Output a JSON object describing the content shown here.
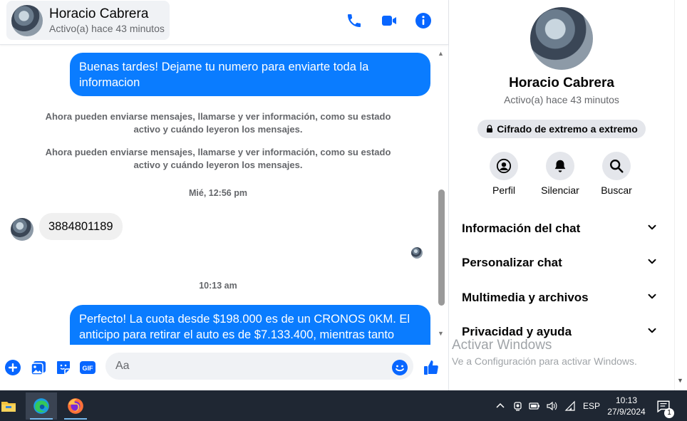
{
  "header": {
    "contact_name": "Horacio Cabrera",
    "contact_status": "Activo(a) hace 43 minutos",
    "icons": [
      "phone-icon",
      "video-camera-icon",
      "info-icon"
    ]
  },
  "messages": {
    "outgoing_1": "Buenas tardes! Dejame tu numero para enviarte toda la informacion",
    "system_1": "Ahora pueden enviarse mensajes, llamarse y ver información, como su estado activo y cuándo leyeron los mensajes.",
    "system_2": "Ahora pueden enviarse mensajes, llamarse y ver información, como su estado activo y cuándo leyeron los mensajes.",
    "time_1": "Mié, 12:56 pm",
    "incoming_1": "3884801189",
    "time_2": "10:13 am",
    "outgoing_2": "Perfecto! La cuota desde $198.000 es de un CRONOS 0KM. El anticipo para retirar el auto es de $7.133.400, mientras tanto"
  },
  "composer": {
    "placeholder": "Aa",
    "gif_label": "GIF",
    "icons": [
      "plus-circle-icon",
      "photo-icon",
      "sticker-icon",
      "gif-icon",
      "emoji-icon",
      "thumbs-up-icon"
    ]
  },
  "info_panel": {
    "name": "Horacio Cabrera",
    "status": "Activo(a) hace 43 minutos",
    "encryption_badge": "Cifrado de extremo a extremo",
    "actions": [
      {
        "label": "Perfil",
        "icon": "profile-icon"
      },
      {
        "label": "Silenciar",
        "icon": "bell-icon"
      },
      {
        "label": "Buscar",
        "icon": "search-icon"
      }
    ],
    "sections": [
      {
        "label": "Información del chat"
      },
      {
        "label": "Personalizar chat"
      },
      {
        "label": "Multimedia y archivos"
      },
      {
        "label": "Privacidad y ayuda"
      }
    ]
  },
  "watermark": {
    "title": "Activar Windows",
    "subtitle": "Ve a Configuración para activar Windows."
  },
  "taskbar": {
    "apps": [
      "file-explorer-icon",
      "edge-icon",
      "firefox-icon"
    ],
    "language": "ESP",
    "time": "10:13",
    "date": "27/9/2024",
    "notification_count": "1"
  },
  "colors": {
    "accent": "#0a7cff",
    "icon_blue": "#0866ff",
    "taskbar_bg": "#1f2733"
  }
}
